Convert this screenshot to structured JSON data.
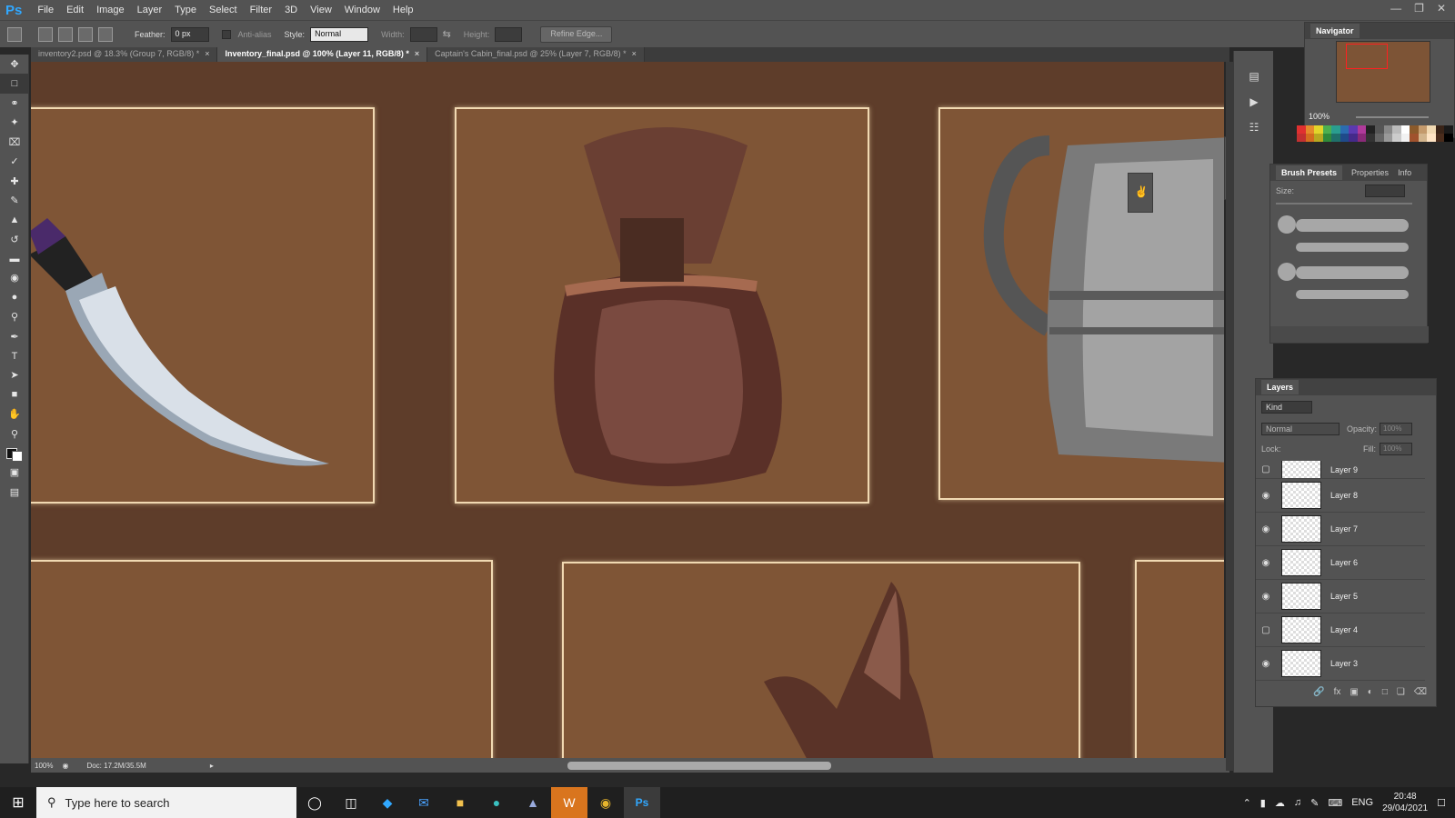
{
  "app": {
    "logo": "Ps",
    "menu": [
      "File",
      "Edit",
      "Image",
      "Layer",
      "Type",
      "Select",
      "Filter",
      "3D",
      "View",
      "Window",
      "Help"
    ]
  },
  "options": {
    "feather_label": "Feather:",
    "feather_value": "0 px",
    "antialias_label": "Anti-alias",
    "style_label": "Style:",
    "style_value": "Normal",
    "width_label": "Width:",
    "height_label": "Height:",
    "refine_label": "Refine Edge..."
  },
  "tabs": [
    {
      "label": "inventory2.psd @ 18.3% (Group 7, RGB/8) *"
    },
    {
      "label": "Inventory_final.psd @ 100% (Layer 11, RGB/8) *"
    },
    {
      "label": "Captain's Cabin_final.psd @ 25% (Layer 7, RGB/8) *"
    }
  ],
  "status": {
    "zoom": "100%",
    "doc": "Doc: 17.2M/35.5M"
  },
  "navigator": {
    "title": "Navigator",
    "zoom": "100%"
  },
  "brush_panel": {
    "tabs": [
      "Brush Presets",
      "Properties",
      "Info"
    ],
    "size_label": "Size:"
  },
  "layers_panel": {
    "title": "Layers",
    "kind": "Kind",
    "blend": "Normal",
    "opacity_label": "Opacity:",
    "opacity_value": "100%",
    "lock_label": "Lock:",
    "fill_label": "Fill:",
    "fill_value": "100%",
    "layers": [
      {
        "name": "Layer 9"
      },
      {
        "name": "Layer 8"
      },
      {
        "name": "Layer 7"
      },
      {
        "name": "Layer 6"
      },
      {
        "name": "Layer 5"
      },
      {
        "name": "Layer 4"
      },
      {
        "name": "Layer 3"
      }
    ]
  },
  "taskbar": {
    "search_placeholder": "Type here to search",
    "lang": "ENG",
    "time": "20:48",
    "date": "29/04/2021"
  },
  "colors": {
    "canvas_bg": "#5e3d2a",
    "slot_fill": "#7f5536",
    "slot_border": "#f1d9b2",
    "ps_blue": "#31a8ff"
  },
  "swatch_colors": [
    "#e03030",
    "#e58a2b",
    "#e3d52a",
    "#4caf50",
    "#2a9d8f",
    "#2b6cb0",
    "#5b3ab0",
    "#b03a9a",
    "#222222",
    "#555555",
    "#888888",
    "#bbbbbb",
    "#ffffff",
    "#8b5a2b",
    "#c49a6c",
    "#f1d9b2",
    "#3a2418",
    "#1a1a1a",
    "#c23030",
    "#d46c1e",
    "#b8a820",
    "#2f8a3a",
    "#1f6f6a",
    "#1f4a8a",
    "#442a8a",
    "#8a2a78",
    "#333333",
    "#666666",
    "#999999",
    "#cccccc",
    "#f2f2f2",
    "#a0522d",
    "#d2b48c",
    "#ffe4c4",
    "#4a2c1c",
    "#000000"
  ]
}
